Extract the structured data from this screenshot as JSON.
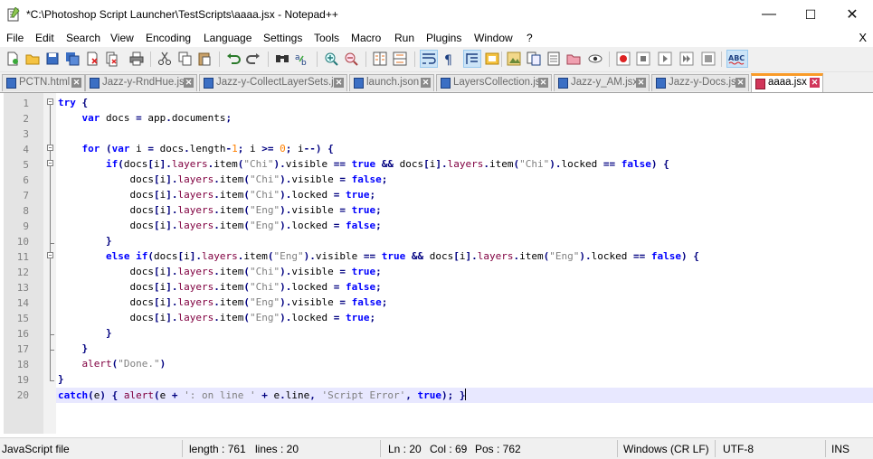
{
  "window": {
    "title": "*C:\\Photoshop Script Launcher\\TestScripts\\aaaa.jsx - Notepad++",
    "minimize": "—",
    "maximize": "☐",
    "close": "✕"
  },
  "menu": {
    "items": [
      "File",
      "Edit",
      "Search",
      "View",
      "Encoding",
      "Language",
      "Settings",
      "Tools",
      "Macro",
      "Run",
      "Plugins",
      "Window",
      "?"
    ],
    "close": "X"
  },
  "tabs": [
    {
      "label": "PCTN.html",
      "active": false
    },
    {
      "label": "Jazz-y-RndHue.jsx",
      "active": false
    },
    {
      "label": "Jazz-y-CollectLayerSets.jsx",
      "active": false
    },
    {
      "label": "launch.json",
      "active": false
    },
    {
      "label": "LayersCollection.jsx",
      "active": false
    },
    {
      "label": "Jazz-y_AM.jsx",
      "active": false
    },
    {
      "label": "Jazz-y-Docs.jsx",
      "active": false
    },
    {
      "label": "aaaa.jsx",
      "active": true
    }
  ],
  "code_lines": [
    "try {",
    "    var docs = app.documents;",
    "",
    "    for (var i = docs.length-1; i >= 0; i--) {",
    "        if(docs[i].layers.item(\"Chi\").visible == true && docs[i].layers.item(\"Chi\").locked == false) {",
    "            docs[i].layers.item(\"Chi\").visible = false;",
    "            docs[i].layers.item(\"Chi\").locked = true;",
    "            docs[i].layers.item(\"Eng\").visible = true;",
    "            docs[i].layers.item(\"Eng\").locked = false;",
    "        }",
    "        else if(docs[i].layers.item(\"Eng\").visible == true && docs[i].layers.item(\"Eng\").locked == false) {",
    "            docs[i].layers.item(\"Chi\").visible = true;",
    "            docs[i].layers.item(\"Chi\").locked = false;",
    "            docs[i].layers.item(\"Eng\").visible = false;",
    "            docs[i].layers.item(\"Eng\").locked = true;",
    "        }",
    "    }",
    "    alert(\"Done.\")",
    "}",
    "catch(e) { alert(e + ': on line ' + e.line, 'Script Error', true); }"
  ],
  "current_line": 20,
  "status": {
    "file_type": "JavaScript file",
    "length": "length : 761",
    "lines": "lines : 20",
    "ln": "Ln : 20",
    "col": "Col : 69",
    "pos": "Pos : 762",
    "eol": "Windows (CR LF)",
    "encoding": "UTF-8",
    "mode": "INS"
  },
  "toolbar": {
    "icons": [
      "new-file-icon",
      "open-file-icon",
      "save-icon",
      "save-all-icon",
      "close-icon",
      "close-all-icon",
      "print-icon",
      "cut-icon",
      "copy-icon",
      "paste-icon",
      "undo-icon",
      "redo-icon",
      "find-icon",
      "replace-icon",
      "zoom-in-icon",
      "zoom-out-icon",
      "sync-vertical-icon",
      "sync-horizontal-icon",
      "word-wrap-icon",
      "show-all-characters-icon",
      "indent-guide-icon",
      "udl-icon",
      "document-map-icon",
      "function-list-icon",
      "doc-list-icon",
      "folder-workspace-icon",
      "monitoring-icon",
      "record-macro-icon",
      "stop-record-icon",
      "play-macro-icon",
      "play-multiple-icon",
      "save-macro-icon",
      "spell-check-icon"
    ],
    "spell_label": "ABC"
  },
  "colors": {
    "active_tab_accent": "#fa9b28",
    "keyword": "#0000ff",
    "number": "#ff8000",
    "string": "#808080",
    "current_line_bg": "#e8e8ff"
  }
}
